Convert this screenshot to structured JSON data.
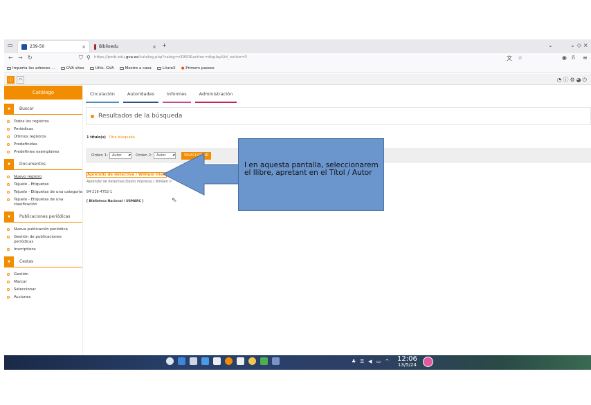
{
  "browser": {
    "tabs": [
      {
        "label": "239-50"
      },
      {
        "label": "Biblioedu"
      }
    ],
    "new_tab": "+",
    "url_prefix": "https://pmb.edu.",
    "url_domain": "gva.es",
    "url_suffix": "/catalog.php?categ=z3950&action=display&id_notice=0",
    "bookmarks": [
      "Importa les adreces ...",
      "GVA sites",
      "Utils. GVA",
      "Mestre a casa",
      "LliureX",
      "Primers passos"
    ]
  },
  "sidebar": {
    "title": "Catálogo",
    "sections": [
      {
        "label": "Buscar",
        "items": [
          "Todos los registros",
          "Periódicas",
          "Últimos registros",
          "Predefinidas",
          "Predefinies exemplaires"
        ]
      },
      {
        "label": "Documentos",
        "items": [
          "Nuevo registro",
          "Tejuelo - Etiquetas",
          "Tejuelo - Etiquetas de una categoría",
          "Tejuelo - Etiquetas de una clasificación"
        ]
      },
      {
        "label": "Publicaciones periódicas",
        "items": [
          "Nueva publicación periódica",
          "Gestión de publicaciones periódicas",
          "Inscriptions"
        ]
      },
      {
        "label": "Cestas",
        "items": [
          "Gestión",
          "Marcar",
          "Seleccionar",
          "Acciones"
        ]
      }
    ]
  },
  "main": {
    "tabs": [
      "Circulación",
      "Autoridades",
      "Informes",
      "Administración"
    ],
    "panel_title": "Resultados de la búsqueda",
    "count_label": "1 título(s)",
    "other_search": "Otra búsqueda",
    "order1_label": "Orden 1:",
    "order1_value": "Autor",
    "order2_label": "Orden 2:",
    "order2_value": "Autor",
    "select_button": "SELECCIONAR",
    "result_title": "Aprendiz de detective / William Irish",
    "result_subtitle": "Aprendiz de detective [texto impreso] / William Ir",
    "result_isbn": "84-216-4752-1",
    "result_library": "[ Biblioteca Nacional / USMARC ]"
  },
  "annotation": {
    "text": "I en aquesta pantalla, seleccionarem el llibre, apretant en el Títol / Autor",
    "color": "#6b96cd"
  },
  "taskbar": {
    "time": "12:06",
    "date": "13/5/24"
  },
  "colors": {
    "accent": "#f28c00"
  }
}
